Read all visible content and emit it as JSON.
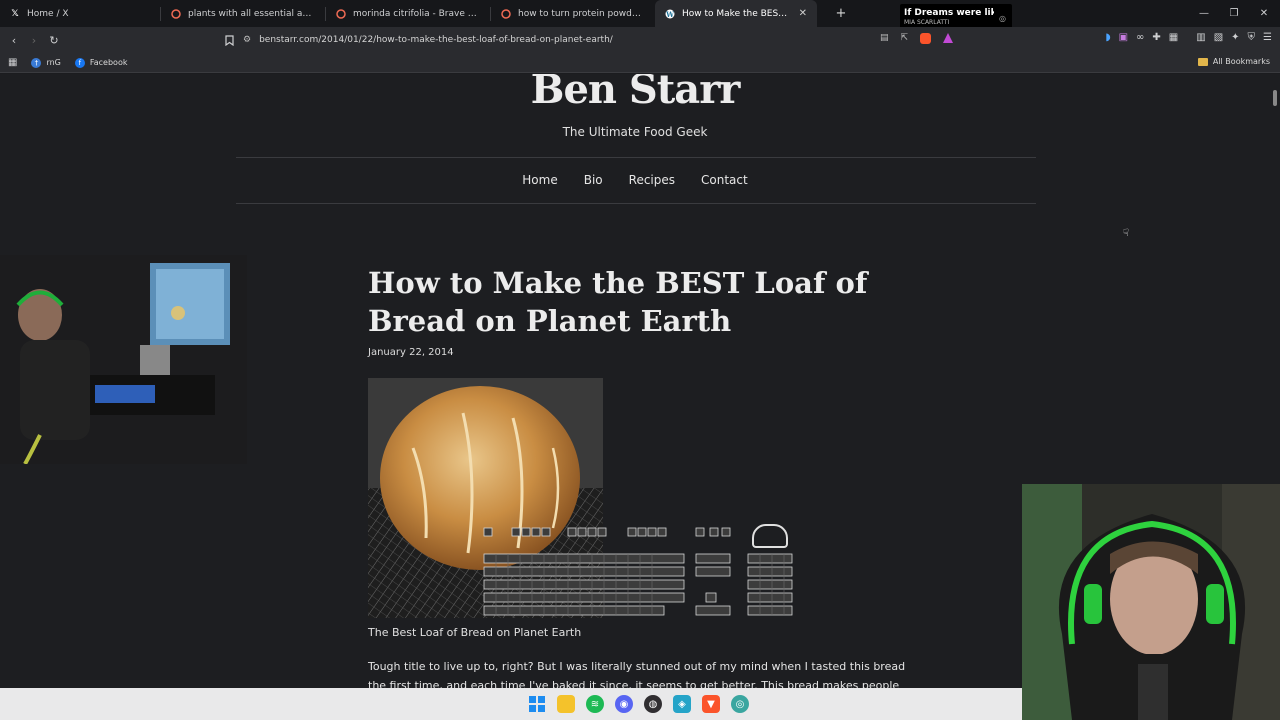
{
  "browser": {
    "tabs": [
      {
        "label": "Home / X",
        "icon": "x-logo-icon",
        "active": false
      },
      {
        "label": "plants with all essential amino acids",
        "icon": "brave-search-icon",
        "active": false
      },
      {
        "label": "morinda citrifolia - Brave Search",
        "icon": "brave-search-icon",
        "active": false
      },
      {
        "label": "how to turn protein powder into a ba",
        "icon": "brave-search-icon",
        "active": false
      },
      {
        "label": "How to Make the BEST Loaf of Br",
        "icon": "wordpress-icon",
        "active": true
      }
    ],
    "new_tab": "+",
    "media": {
      "title": "If Dreams were like",
      "artist": "MIA SCARLATTI"
    },
    "window_controls": {
      "minimize": "—",
      "restore": "❐",
      "close": "✕"
    },
    "url": "benstarr.com/2014/01/22/how-to-make-the-best-loaf-of-bread-on-planet-earth/",
    "bookmarks": [
      {
        "label": "rnG",
        "color": "#3a7bd5"
      },
      {
        "label": "Facebook",
        "color": "#1877f2"
      }
    ],
    "all_bookmarks": "All Bookmarks"
  },
  "site": {
    "title": "Ben Starr",
    "tagline": "The Ultimate Food Geek",
    "nav": [
      "Home",
      "Bio",
      "Recipes",
      "Contact"
    ]
  },
  "post": {
    "title": "How to Make the BEST Loaf of Bread on Planet Earth",
    "date": "January 22, 2014",
    "caption": "The Best Loaf of Bread on Planet Earth",
    "body": "Tough title to live up to, right?  But I was literally stunned out of my mind when I tasted this bread the first time, and each time I've baked it since, it seems to get better.  This bread makes people scream.  Literally."
  },
  "colors": {
    "page_bg": "#1d1e21",
    "tab_bg": "#16171a",
    "toolbar_bg": "#2a2b2f",
    "taskbar_bg": "#e9e9ea"
  }
}
